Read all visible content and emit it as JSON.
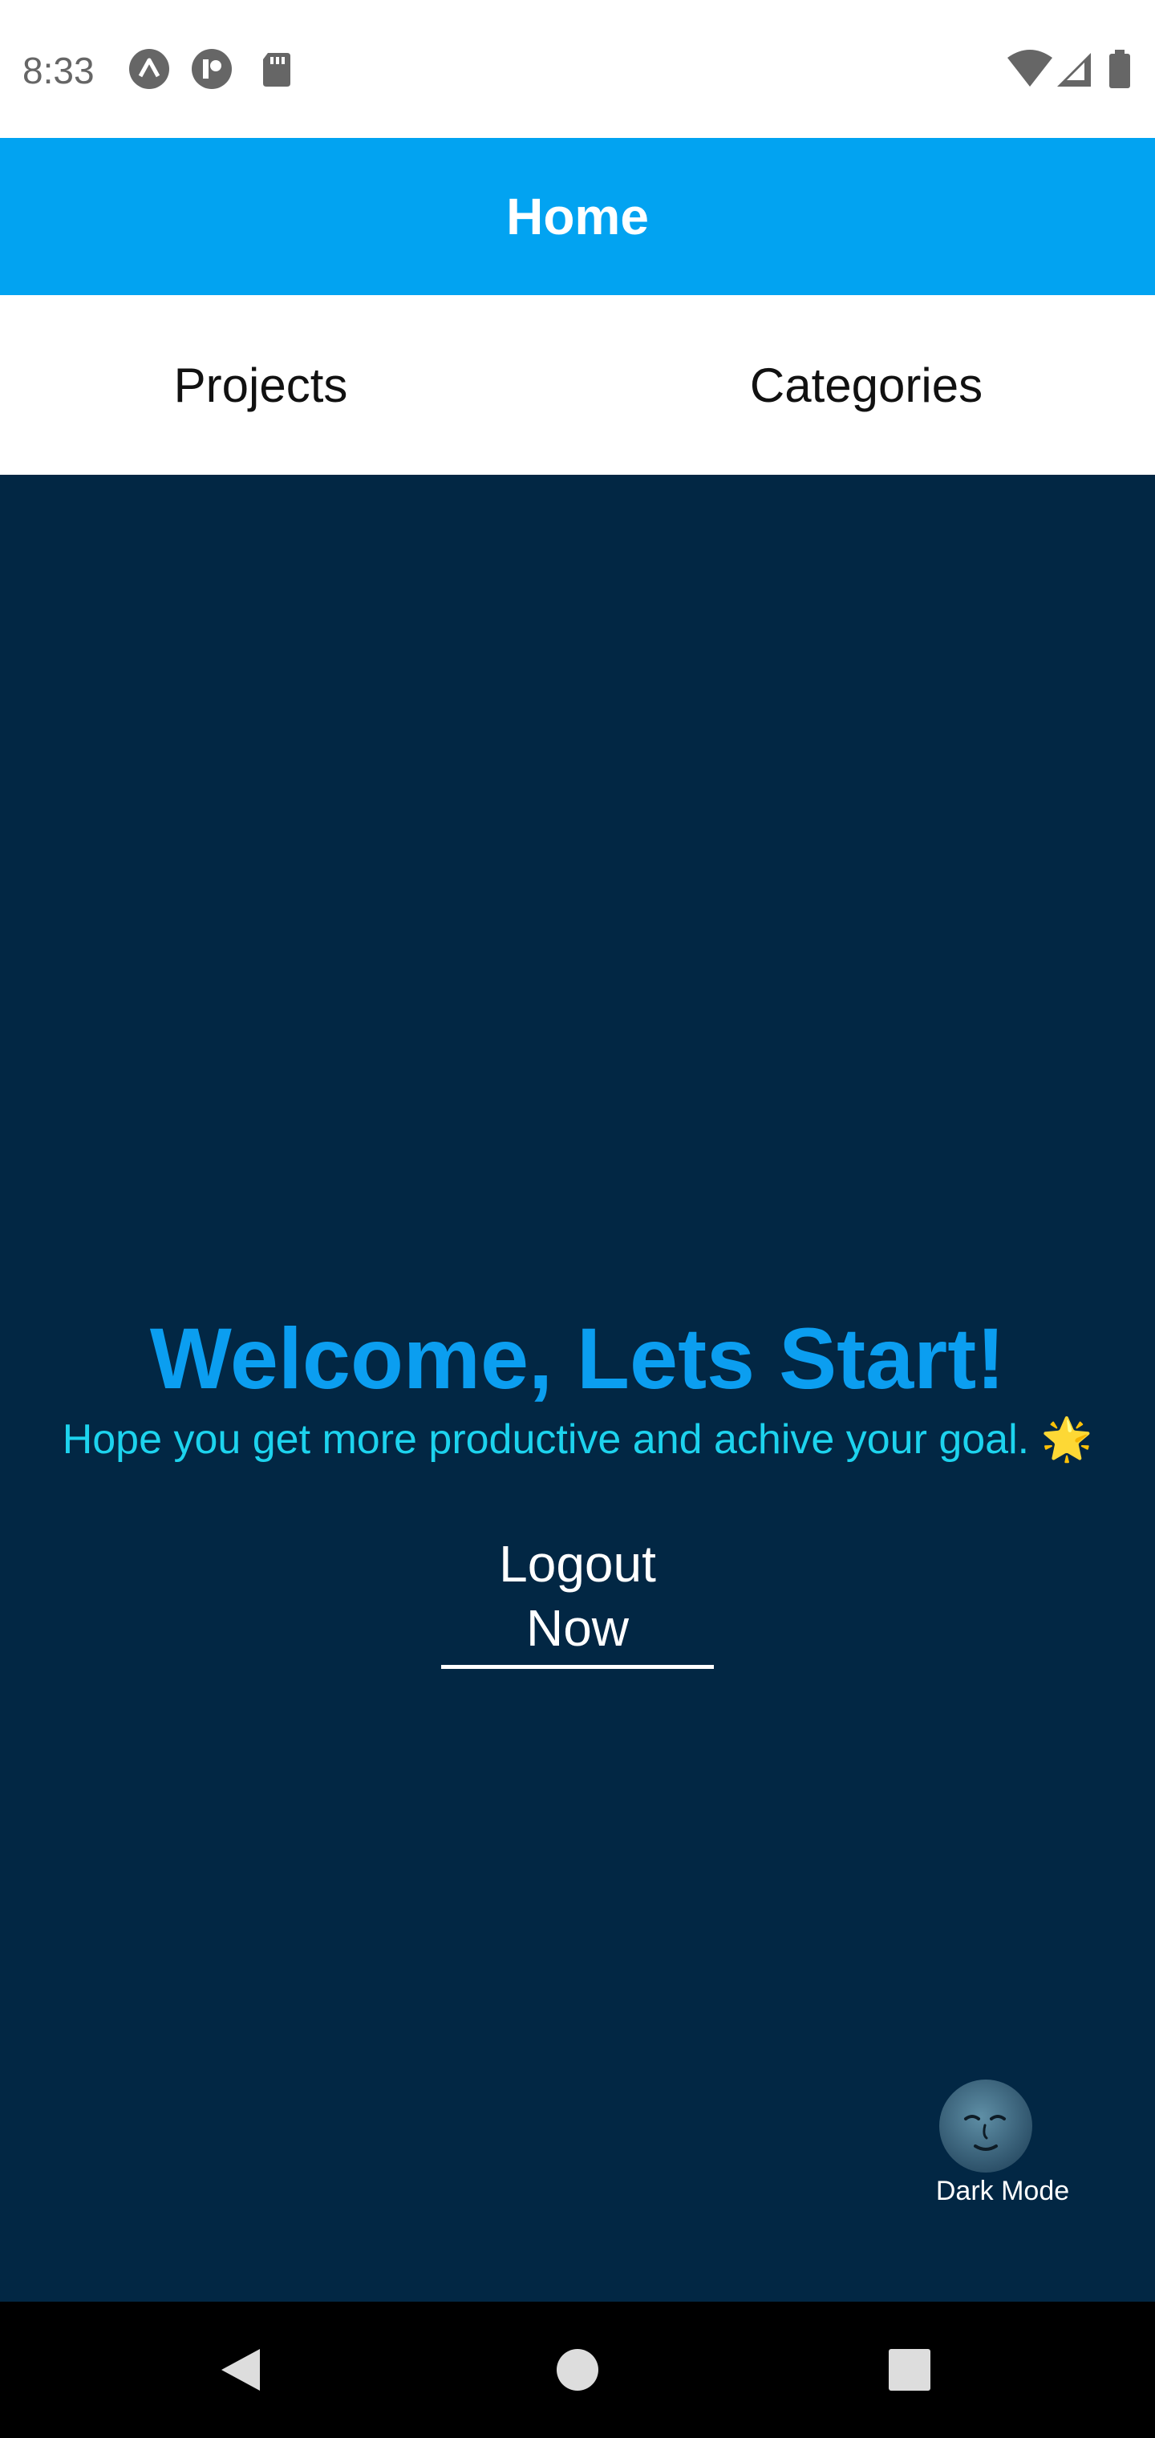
{
  "status_bar": {
    "time": "8:33",
    "icons": [
      "expo-icon",
      "custom-app-icon",
      "sd-card-icon",
      "wifi-icon",
      "signal-icon",
      "battery-icon"
    ]
  },
  "header": {
    "title": "Home"
  },
  "tabs": [
    {
      "label": "Projects"
    },
    {
      "label": "Categories"
    }
  ],
  "main": {
    "welcome_title": "Welcome, Lets Start!",
    "subtitle": "Hope you get more productive and achive your goal. 🌟",
    "logout_label": "Logout Now",
    "dark_mode_label": "Dark Mode"
  },
  "colors": {
    "header_bg": "#02a3f1",
    "main_bg": "#022744",
    "title": "#0b9ef0",
    "subtitle": "#1dd3ee"
  },
  "nav_bar": {
    "buttons": [
      "back-icon",
      "home-icon",
      "recents-icon"
    ]
  }
}
